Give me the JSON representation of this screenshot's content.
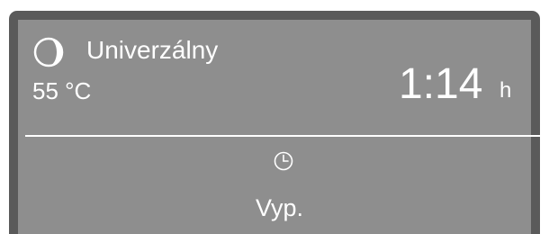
{
  "display": {
    "program_icon": "half-moon-icon",
    "program_name": "Univerzálny",
    "temperature": "55 °C",
    "remaining_time": "1:14",
    "time_unit": "h",
    "clock_icon": "clock-icon",
    "delay_start_value": "Vyp."
  },
  "colors": {
    "bezel": "#5a5a5a",
    "screen": "#8e8e8e",
    "text": "#ffffff"
  }
}
